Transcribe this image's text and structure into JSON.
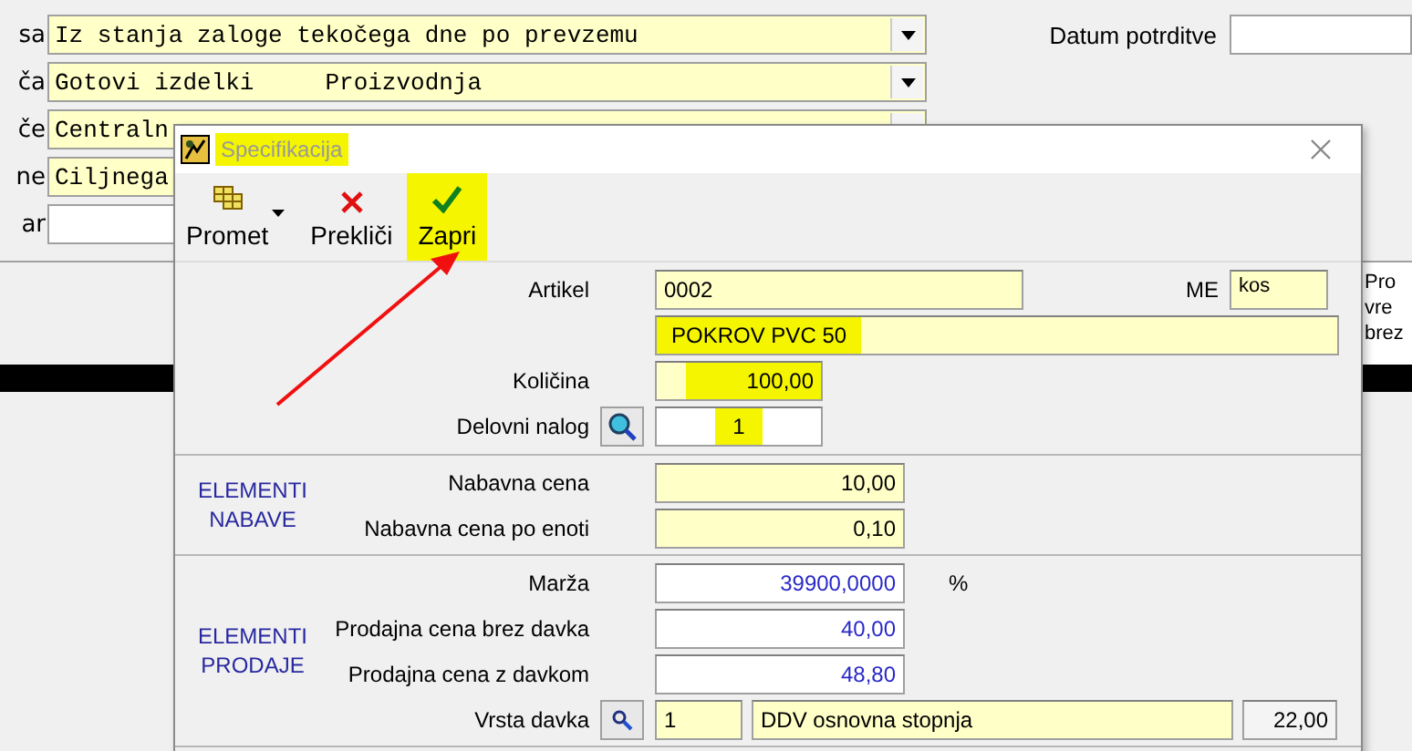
{
  "background": {
    "rows": [
      {
        "kind": "combo",
        "label_fragment": "sa",
        "value": "Iz stanja zaloge tekočega dne po prevzemu"
      },
      {
        "kind": "combo",
        "label_fragment": "ča",
        "value": "Gotovi izdelki     Proizvodnja"
      },
      {
        "kind": "combo",
        "label_fragment": "če",
        "value": "Centraln"
      },
      {
        "kind": "combo",
        "label_fragment": "ne",
        "value": "Ciljnega"
      },
      {
        "kind": "input",
        "label_fragment": "ar"
      }
    ],
    "date_field": {
      "label": "Datum potrditve"
    },
    "table": {
      "column_header": [
        "Pro",
        "vre",
        "brez"
      ]
    }
  },
  "dialog": {
    "title": "Specifikacija",
    "title_highlighted": true,
    "toolbar": [
      {
        "kind": "menu",
        "label": "Promet",
        "dropdown": true,
        "highlighted": false
      },
      {
        "kind": "cancel",
        "label": "Prekliči",
        "dropdown": false,
        "highlighted": false
      },
      {
        "kind": "confirm",
        "label": "Zapri",
        "dropdown": false,
        "highlighted": true
      }
    ],
    "artikel": {
      "label": "Artikel",
      "value": "0002",
      "unit_label": "ME",
      "unit": "kos",
      "name": "POKROV PVC 50",
      "name_highlighted": true
    },
    "kolicina": {
      "label": "Količina",
      "value": "100,00",
      "highlighted": true
    },
    "delovni_nalog": {
      "label": "Delovni nalog",
      "value": "1",
      "highlighted": true
    },
    "sections": [
      {
        "title": [
          "ELEMENTI",
          "NABAVE"
        ],
        "rows": [
          {
            "kind": "field",
            "label": "Nabavna cena",
            "value": "10,00",
            "editable": false
          },
          {
            "kind": "field",
            "label": "Nabavna cena po enoti",
            "value": "0,10",
            "editable": false
          }
        ]
      },
      {
        "title": [
          "ELEMENTI",
          "PRODAJE"
        ],
        "rows": [
          {
            "kind": "field",
            "label": "Marža",
            "value": "39900,0000",
            "editable": true,
            "suffix": "%"
          },
          {
            "kind": "field",
            "label": "Prodajna cena brez davka",
            "value": "40,00",
            "editable": true
          },
          {
            "kind": "field",
            "label": "Prodajna cena z davkom",
            "value": "48,80",
            "editable": true
          },
          {
            "kind": "tax",
            "label": "Vrsta davka",
            "code": "1",
            "name": "DDV osnovna stopnja",
            "rate": "22,00"
          }
        ]
      }
    ]
  }
}
